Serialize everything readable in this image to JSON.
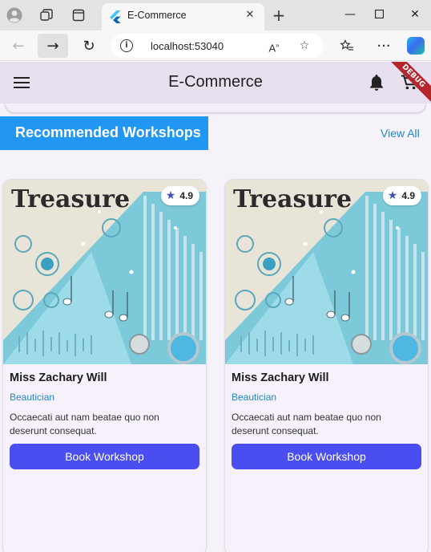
{
  "browser": {
    "tab": {
      "title": "E-Commerce"
    },
    "address": {
      "url": "localhost:53040"
    },
    "icons": {
      "profile": "profile-icon",
      "workspaces": "workspaces-icon",
      "tab_actions": "tab-actions-icon",
      "close_tab": "close-icon",
      "new_tab": "plus-icon",
      "minimize": "minimize-icon",
      "maximize": "maximize-icon",
      "close_window": "close-icon",
      "back": "back-arrow-icon",
      "forward": "forward-arrow-icon",
      "refresh": "refresh-icon",
      "site_info": "info-icon",
      "read_aloud": "read-aloud-icon",
      "favorite": "star-icon",
      "favorites": "favorites-icon",
      "more": "ellipsis-icon",
      "copilot": "copilot-icon"
    }
  },
  "app": {
    "title": "E-Commerce",
    "debug_banner": "DEBUG",
    "colors": {
      "appbar": "#e8e0ef",
      "section_header": "#2196f3",
      "accent_button": "#4a4ef0",
      "link": "#1e88c8",
      "rating_star": "#3f51b5"
    },
    "section": {
      "title": "Recommended Workshops",
      "view_all": "View All"
    },
    "cards": [
      {
        "image_title": "Treasure",
        "rating": "4.9",
        "name": "Miss Zachary Will",
        "role": "Beautician",
        "description": "Occaecati aut nam beatae quo non deserunt consequat.",
        "button": "Book Workshop"
      },
      {
        "image_title": "Treasure",
        "rating": "4.9",
        "name": "Miss Zachary Will",
        "role": "Beautician",
        "description": "Occaecati aut nam beatae quo non deserunt consequat.",
        "button": "Book Workshop"
      }
    ]
  }
}
